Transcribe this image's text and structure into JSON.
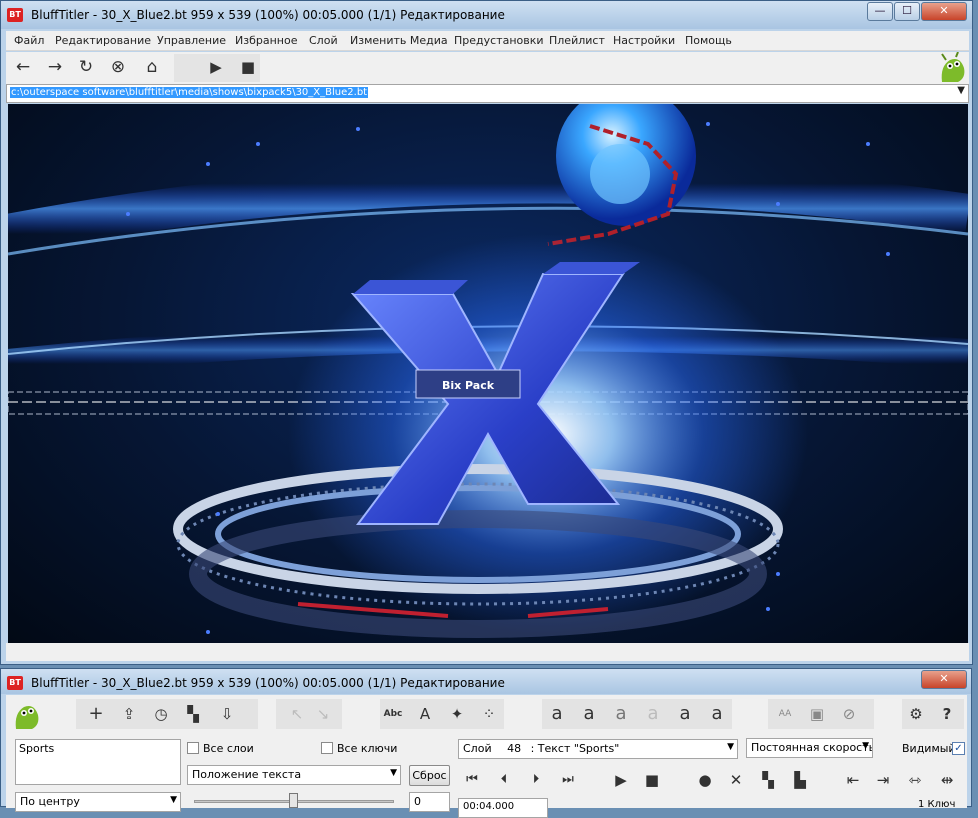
{
  "main_window": {
    "title": "BluffTitler - 30_X_Blue2.bt 959 x 539 (100%) 00:05.000 (1/1) Редактирование",
    "app_icon_label": "BT",
    "window_buttons": {
      "minimize": "—",
      "maximize": "☐",
      "close": "✕"
    }
  },
  "menu": {
    "items": [
      "Файл",
      "Редактирование",
      "Управление",
      "Избранное",
      "Слой",
      "Изменить Медиа",
      "Предустановки",
      "Плейлист",
      "Настройки",
      "Помощь"
    ]
  },
  "toolbar": {
    "icons": {
      "back": "←",
      "forward": "→",
      "refresh": "↻",
      "stop": "⊗",
      "home": "⌂",
      "play": "▶",
      "stop_square": "■"
    }
  },
  "path": {
    "value": "c:\\outerspace software\\blufftitler\\media\\shows\\bixpack5\\30_X_Blue2.bt",
    "dropdown": "▼"
  },
  "viewport": {
    "scene_letter": "X",
    "scene_label": "Bix Pack",
    "colors": {
      "background": "#061634",
      "glow": "#2b6dff",
      "ring": "#c9d4e6"
    }
  },
  "control_window": {
    "title": "BluffTitler - 30_X_Blue2.bt 959 x 539 (100%) 00:05.000 (1/1) Редактирование",
    "close": "✕",
    "text_value": "Sports",
    "all_layers_label": "Все слои",
    "all_keys_label": "Все ключи",
    "layer_select": {
      "prefix": "Слой",
      "number": "48",
      "value": ": Текст \"Sports\""
    },
    "speed_select": "Постоянная скорость",
    "visible_label": "Видимый",
    "property_select": "Положение текста",
    "reset_button": "Сброс",
    "align_select": "По центру",
    "number_field": "0",
    "time_field": "00:04.000",
    "keys_count": "1 Ключ",
    "icons": {
      "add": "+",
      "import": "⇪",
      "clock": "◷",
      "layers": "▚",
      "export": "⇩",
      "abc": "Abc",
      "font": "A",
      "shape": "✦",
      "particles": "⁘",
      "text_a1": "a",
      "text_a2": "a",
      "text_a3": "a",
      "text_a4": "a",
      "text_a5": "a",
      "text_a6": "a",
      "aa": "AA",
      "media": "▣",
      "slash": "⊘",
      "settings": "⚙",
      "help": "?",
      "first": "⏮",
      "prev": "⏴",
      "next": "⏵",
      "last": "⏭",
      "play": "▶",
      "stop": "■",
      "record": "●",
      "delete": "✕",
      "copy": "▚",
      "paste": "▙",
      "key_left": "⇤",
      "key_right": "⇥",
      "key_both": "⇿",
      "key_split": "⇹"
    }
  }
}
